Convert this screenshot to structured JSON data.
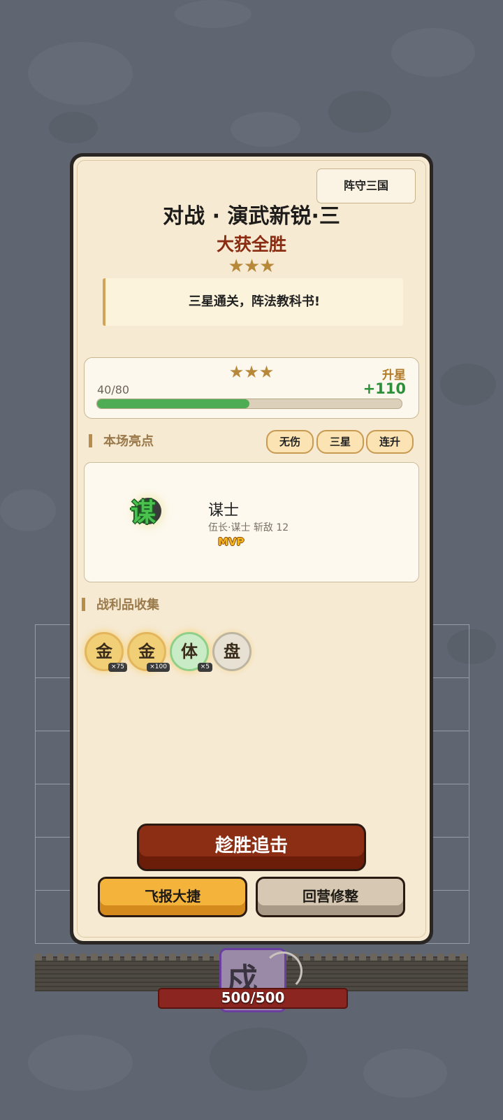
{
  "tag_label": "阵守三国",
  "title": "对战 · 演武新锐·三",
  "result": "大获全胜",
  "stars": "★★★",
  "quote": "三星通关，阵法教科书!",
  "progress": {
    "stars": "★★★",
    "upgrade_label": "升星",
    "count": "40/80",
    "bonus": "+110",
    "fill_fraction": 0.5
  },
  "highlights": {
    "heading": "本场亮点",
    "chips": [
      "无伤",
      "三星",
      "连升"
    ]
  },
  "mvp_card": {
    "icon_char": "谋",
    "name": "谋士",
    "desc": "伍长·谋士 斩敌 12",
    "badge": "MVP"
  },
  "loot": {
    "heading": "战利品收集",
    "items": [
      {
        "char": "金",
        "qty": "×75"
      },
      {
        "char": "金",
        "qty": "×100"
      },
      {
        "char": "体",
        "qty": "×5"
      },
      {
        "char": "盘",
        "qty": ""
      }
    ]
  },
  "buttons": {
    "pursue": "趁胜追击",
    "report": "飞报大捷",
    "rest": "回营修整"
  },
  "battlefield": {
    "unit_char": "戍",
    "hp": "500/500"
  }
}
